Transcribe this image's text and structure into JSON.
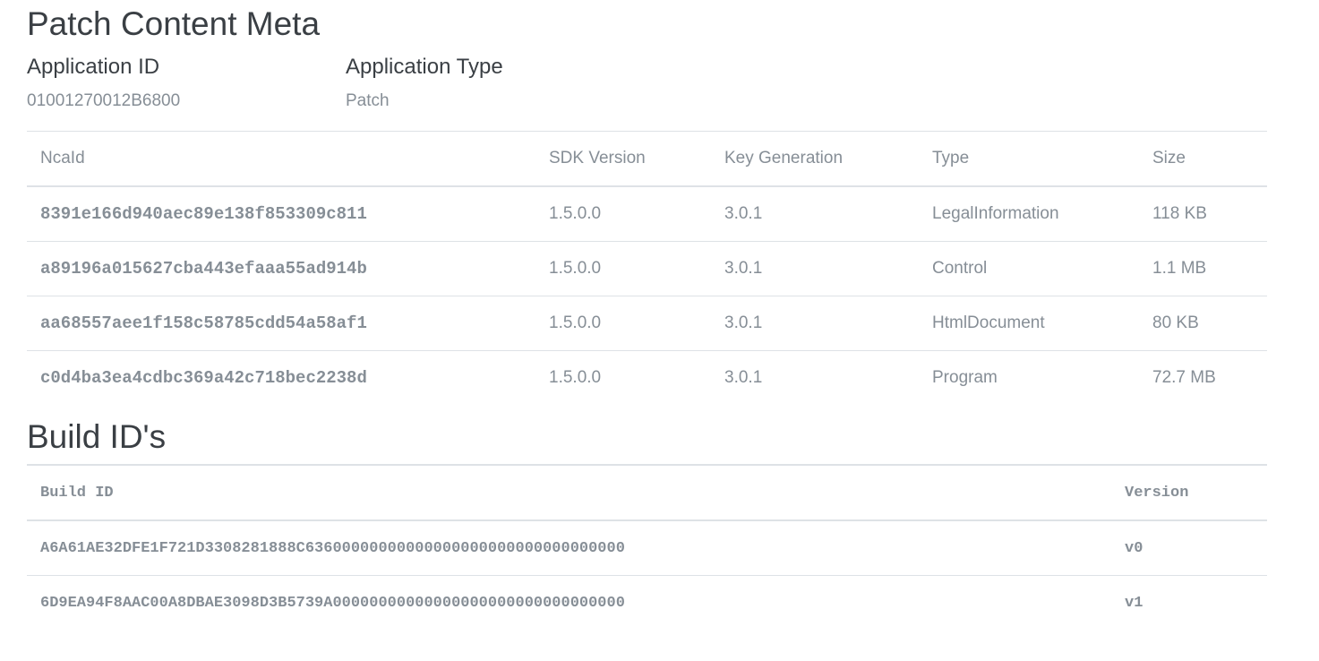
{
  "page": {
    "title": "Patch Content Meta"
  },
  "meta": {
    "application_id_label": "Application ID",
    "application_id_value": "01001270012B6800",
    "application_type_label": "Application Type",
    "application_type_value": "Patch"
  },
  "nca_table": {
    "headers": [
      "NcaId",
      "SDK Version",
      "Key Generation",
      "Type",
      "Size"
    ],
    "rows": [
      {
        "nca_id": "8391e166d940aec89e138f853309c811",
        "sdk_version": "1.5.0.0",
        "key_generation": "3.0.1",
        "type": "LegalInformation",
        "size": "118 KB"
      },
      {
        "nca_id": "a89196a015627cba443efaaa55ad914b",
        "sdk_version": "1.5.0.0",
        "key_generation": "3.0.1",
        "type": "Control",
        "size": "1.1 MB"
      },
      {
        "nca_id": "aa68557aee1f158c58785cdd54a58af1",
        "sdk_version": "1.5.0.0",
        "key_generation": "3.0.1",
        "type": "HtmlDocument",
        "size": "80 KB"
      },
      {
        "nca_id": "c0d4ba3ea4cdbc369a42c718bec2238d",
        "sdk_version": "1.5.0.0",
        "key_generation": "3.0.1",
        "type": "Program",
        "size": "72.7 MB"
      }
    ]
  },
  "build": {
    "title": "Build ID's",
    "headers": [
      "Build ID",
      "Version"
    ],
    "rows": [
      {
        "build_id": "A6A61AE32DFE1F721D3308281888C63600000000000000000000000000000000",
        "version": "v0"
      },
      {
        "build_id": "6D9EA94F8AAC00A8DBAE3098D3B5739A00000000000000000000000000000000",
        "version": "v1"
      }
    ]
  }
}
